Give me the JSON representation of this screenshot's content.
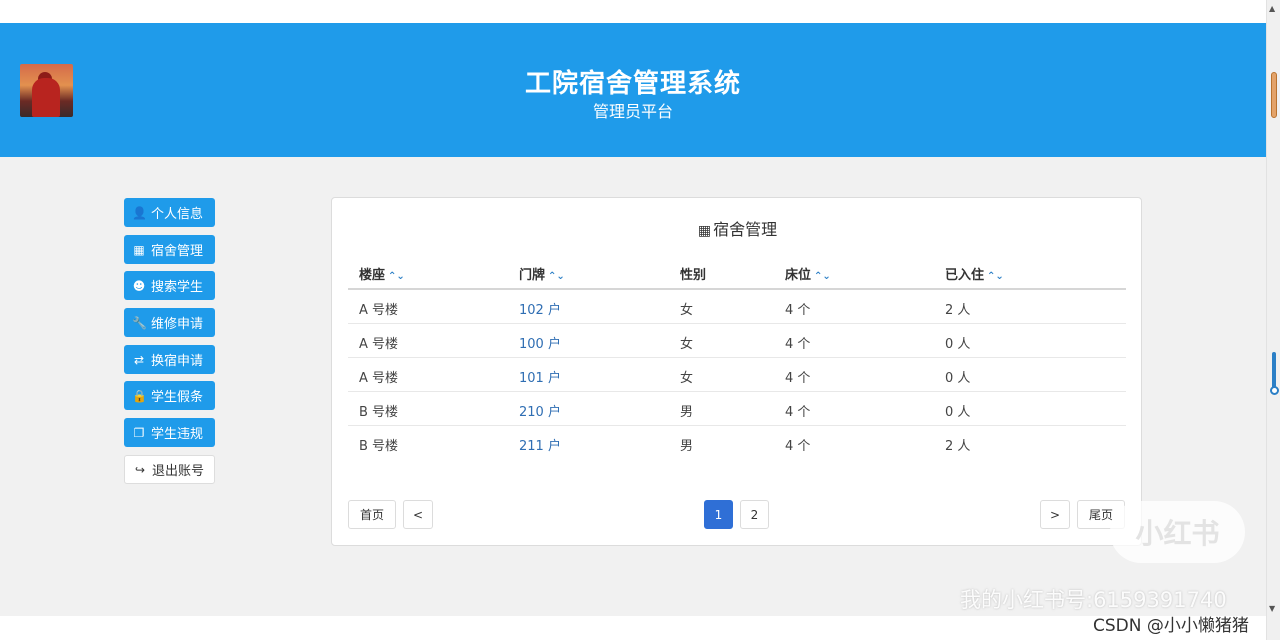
{
  "header": {
    "title": "工院宿舍管理系统",
    "subtitle": "管理员平台"
  },
  "sidebar": {
    "items": [
      {
        "label": "个人信息",
        "icon": "user-icon",
        "glyph": "👤"
      },
      {
        "label": "宿舍管理",
        "icon": "building-icon",
        "glyph": "▦"
      },
      {
        "label": "搜索学生",
        "icon": "user-search-icon",
        "glyph": "☻"
      },
      {
        "label": "维修申请",
        "icon": "wrench-icon",
        "glyph": "🔧"
      },
      {
        "label": "换宿申请",
        "icon": "exchange-icon",
        "glyph": "⇄"
      },
      {
        "label": "学生假条",
        "icon": "lock-icon",
        "glyph": "🔒"
      },
      {
        "label": "学生违规",
        "icon": "copy-icon",
        "glyph": "❐"
      },
      {
        "label": "退出账号",
        "icon": "sign-out-icon",
        "glyph": "↪"
      }
    ]
  },
  "main": {
    "title": "宿舍管理",
    "title_icon_glyph": "▦",
    "columns": [
      "楼座",
      "门牌",
      "性别",
      "床位",
      "已入住"
    ],
    "sort_glyph": "⌃⌄",
    "rows": [
      [
        "A 号楼",
        "102 户",
        "女",
        "4 个",
        "2 人"
      ],
      [
        "A 号楼",
        "100 户",
        "女",
        "4 个",
        "0 人"
      ],
      [
        "A 号楼",
        "101 户",
        "女",
        "4 个",
        "0 人"
      ],
      [
        "B 号楼",
        "210 户",
        "男",
        "4 个",
        "0 人"
      ],
      [
        "B 号楼",
        "211 户",
        "男",
        "4 个",
        "2 人"
      ]
    ]
  },
  "pagination": {
    "first": "首页",
    "prev": "<",
    "pages": [
      "1",
      "2"
    ],
    "current": "1",
    "next": ">",
    "last": "尾页"
  },
  "watermark": {
    "logo": "小红书",
    "account": "我的小红书号:6159391740",
    "credit": "CSDN @小小懒猪猪"
  },
  "scrollbar": {
    "up": "▲",
    "down": "▼"
  },
  "colors": {
    "header": "#1f9bea",
    "button": "#1f9bea",
    "link": "#2f6eb3",
    "active_page": "#2f6fd6"
  }
}
